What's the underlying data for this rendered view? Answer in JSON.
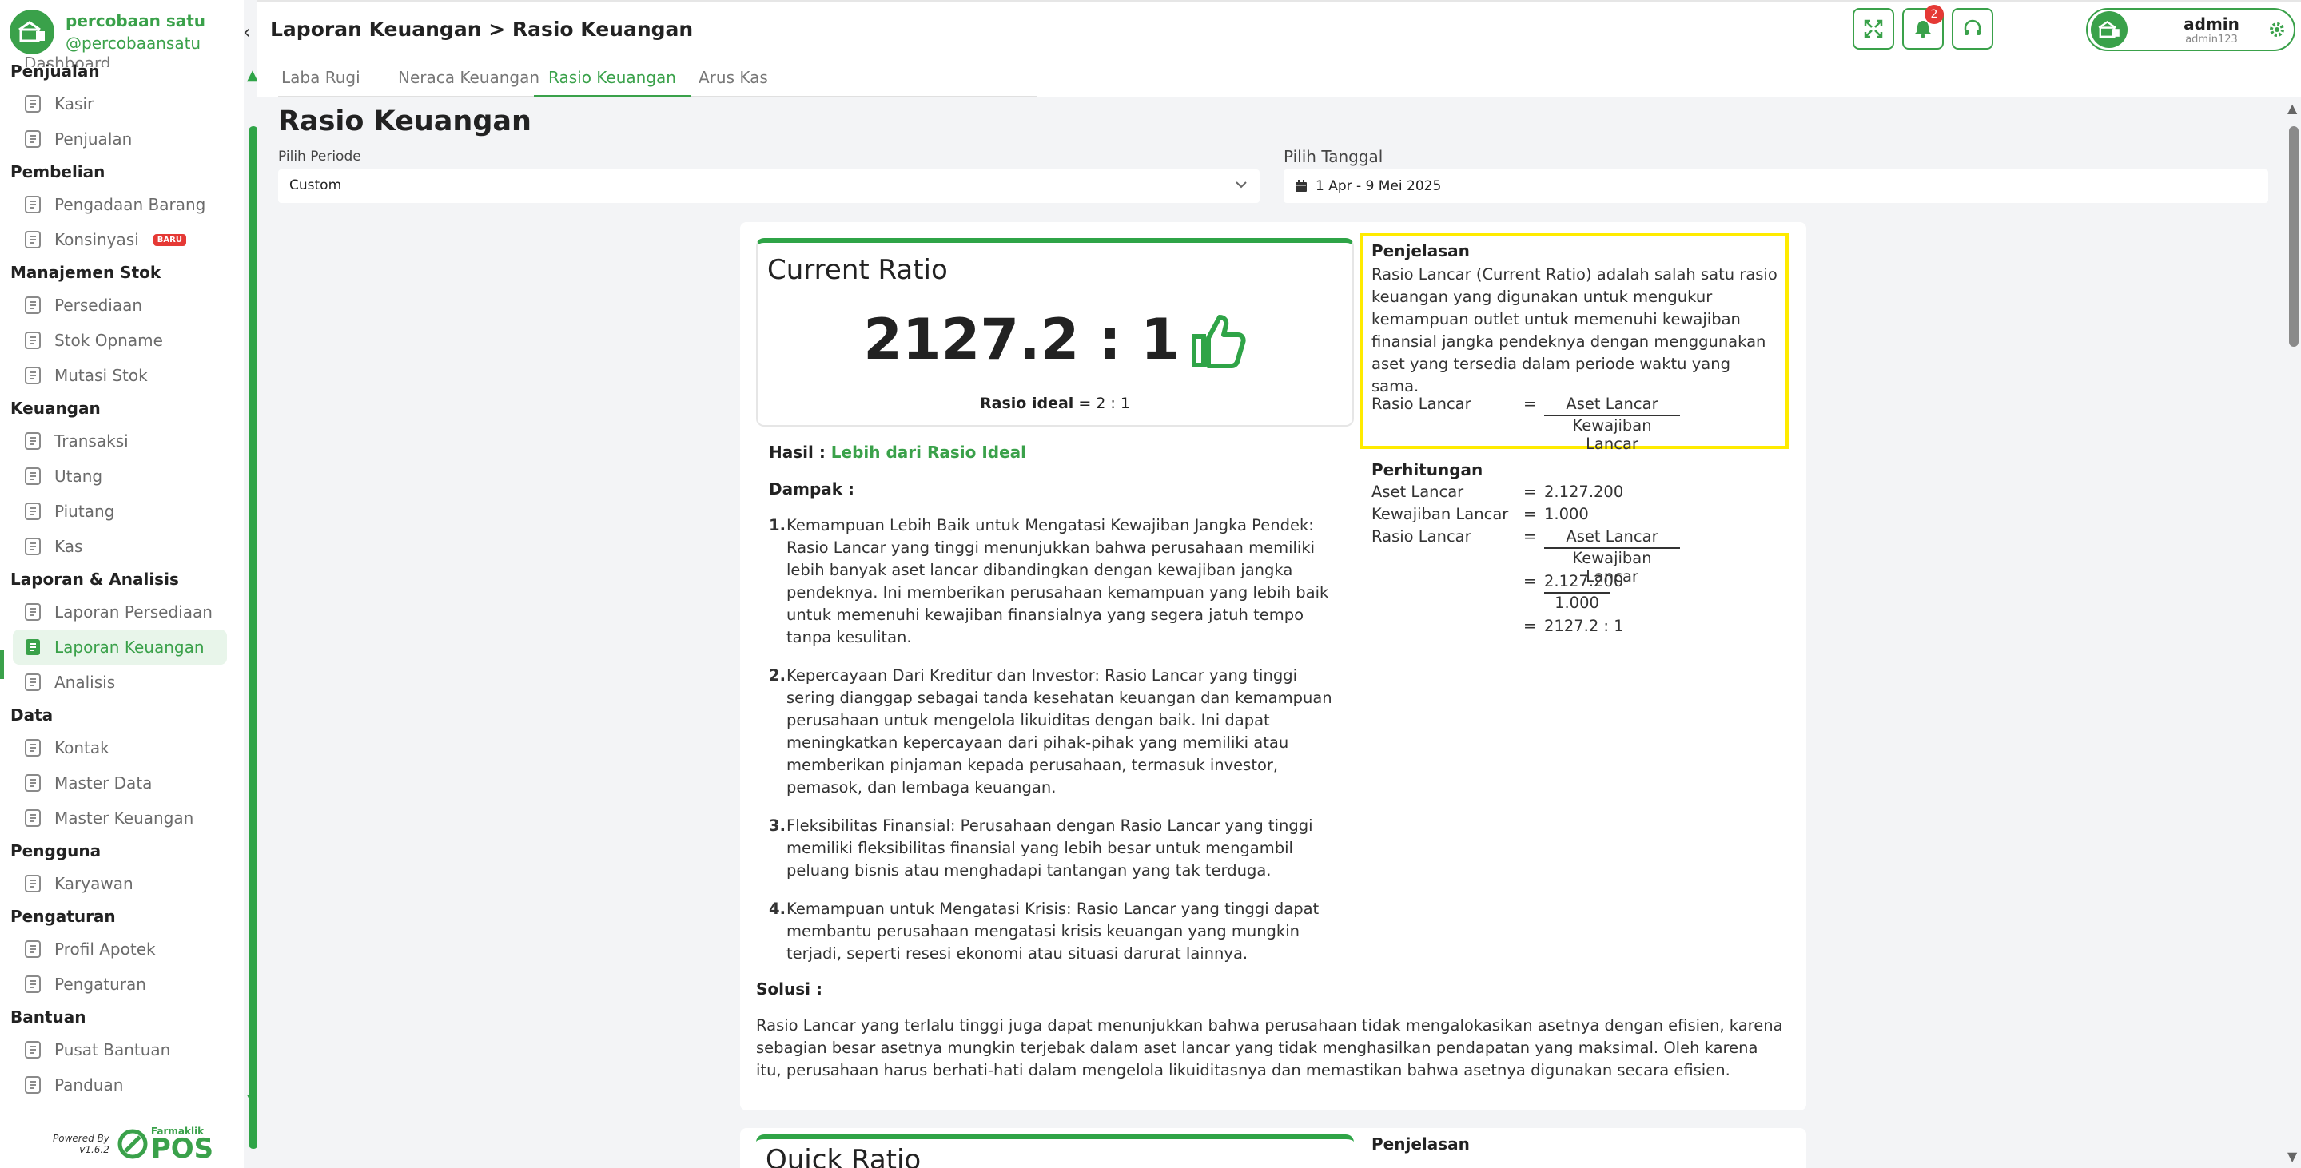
{
  "brand": {
    "name": "percobaan satu",
    "handle": "@percobaansatu"
  },
  "sidebar": {
    "partial_item": "Dashboard",
    "groups": [
      {
        "title": "Penjualan",
        "items": [
          {
            "label": "Kasir",
            "icon": "cashier-icon"
          },
          {
            "label": "Penjualan",
            "icon": "shop-icon"
          }
        ]
      },
      {
        "title": "Pembelian",
        "items": [
          {
            "label": "Pengadaan Barang",
            "icon": "procurement-icon"
          },
          {
            "label": "Konsinyasi",
            "icon": "box-icon",
            "badge": "BARU"
          }
        ]
      },
      {
        "title": "Manajemen Stok",
        "items": [
          {
            "label": "Persediaan",
            "icon": "inventory-icon"
          },
          {
            "label": "Stok Opname",
            "icon": "stock-opname-icon"
          },
          {
            "label": "Mutasi Stok",
            "icon": "stock-mutation-icon"
          }
        ]
      },
      {
        "title": "Keuangan",
        "items": [
          {
            "label": "Transaksi",
            "icon": "transaction-icon"
          },
          {
            "label": "Utang",
            "icon": "debt-icon"
          },
          {
            "label": "Piutang",
            "icon": "receivable-icon"
          },
          {
            "label": "Kas",
            "icon": "cash-icon"
          }
        ]
      },
      {
        "title": "Laporan & Analisis",
        "items": [
          {
            "label": "Laporan Persediaan",
            "icon": "clipboard-icon"
          },
          {
            "label": "Laporan Keuangan",
            "icon": "clipboard-filled-icon",
            "active": true
          },
          {
            "label": "Analisis",
            "icon": "analysis-icon"
          }
        ]
      },
      {
        "title": "Data",
        "items": [
          {
            "label": "Kontak",
            "icon": "contact-icon"
          },
          {
            "label": "Master Data",
            "icon": "master-data-icon"
          },
          {
            "label": "Master Keuangan",
            "icon": "finance-master-icon"
          }
        ]
      },
      {
        "title": "Pengguna",
        "items": [
          {
            "label": "Karyawan",
            "icon": "users-icon"
          }
        ]
      },
      {
        "title": "Pengaturan",
        "items": [
          {
            "label": "Profil Apotek",
            "icon": "store-icon"
          },
          {
            "label": "Pengaturan",
            "icon": "gear-icon"
          }
        ]
      },
      {
        "title": "Bantuan",
        "items": [
          {
            "label": "Pusat Bantuan",
            "icon": "help-icon"
          },
          {
            "label": "Panduan",
            "icon": "guide-icon"
          }
        ]
      }
    ],
    "powered": {
      "line1": "Powered By",
      "line2": "v1.6.2",
      "logo_top": "Farmaklik",
      "logo_big": "POS"
    }
  },
  "header": {
    "breadcrumb": "Laporan Keuangan > Rasio Keuangan",
    "notif_count": "2",
    "user_name": "admin",
    "user_sub": "admin123"
  },
  "tabs": [
    "Laba Rugi",
    "Neraca Keuangan",
    "Rasio Keuangan",
    "Arus Kas"
  ],
  "active_tab": 2,
  "page": {
    "title": "Rasio Keuangan",
    "periode_label": "Pilih Periode",
    "periode_value": "Custom",
    "tanggal_label": "Pilih Tanggal",
    "tanggal_value": "1 Apr - 9 Mei 2025"
  },
  "current_ratio": {
    "title": "Current Ratio",
    "value": "2127.2 : 1",
    "ideal_label": "Rasio ideal",
    "ideal_value": "= 2 : 1",
    "hasil_label": "Hasil :",
    "hasil_value": "Lebih dari Rasio Ideal",
    "dampak_label": "Dampak :",
    "dampak": [
      "Kemampuan Lebih Baik untuk Mengatasi Kewajiban Jangka Pendek: Rasio Lancar yang tinggi menunjukkan bahwa perusahaan memiliki lebih banyak aset lancar dibandingkan dengan kewajiban jangka pendeknya. Ini memberikan perusahaan kemampuan yang lebih baik untuk memenuhi kewajiban finansialnya yang segera jatuh tempo tanpa kesulitan.",
      "Kepercayaan Dari Kreditur dan Investor: Rasio Lancar yang tinggi sering dianggap sebagai tanda kesehatan keuangan dan kemampuan perusahaan untuk mengelola likuiditas dengan baik. Ini dapat meningkatkan kepercayaan dari pihak-pihak yang memiliki atau memberikan pinjaman kepada perusahaan, termasuk investor, pemasok, dan lembaga keuangan.",
      "Fleksibilitas Finansial: Perusahaan dengan Rasio Lancar yang tinggi memiliki fleksibilitas finansial yang lebih besar untuk mengambil peluang bisnis atau menghadapi tantangan yang tak terduga.",
      "Kemampuan untuk Mengatasi Krisis: Rasio Lancar yang tinggi dapat membantu perusahaan mengatasi krisis keuangan yang mungkin terjadi, seperti resesi ekonomi atau situasi darurat lainnya."
    ],
    "solusi_label": "Solusi :",
    "solusi": "Rasio Lancar yang terlalu tinggi juga dapat menunjukkan bahwa perusahaan tidak mengalokasikan asetnya dengan efisien, karena sebagian besar asetnya mungkin terjebak dalam aset lancar yang tidak menghasilkan pendapatan yang maksimal. Oleh karena itu, perusahaan harus berhati-hati dalam mengelola likuiditasnya dan memastikan bahwa asetnya digunakan secara efisien.",
    "penjelasan_label": "Penjelasan",
    "penjelasan": "Rasio Lancar (Current Ratio) adalah salah satu rasio keuangan yang digunakan untuk mengukur kemampuan outlet untuk memenuhi kewajiban finansial jangka pendeknya dengan menggunakan aset yang tersedia dalam periode waktu yang sama.",
    "formula": {
      "label": "Rasio Lancar",
      "eq": "=",
      "numerator": "Aset Lancar",
      "denominator": "Kewajiban Lancar"
    },
    "perhitungan_label": "Perhitungan",
    "perhitungan": {
      "aset_label": "Aset Lancar",
      "aset_value": "2.127.200",
      "kewajiban_label": "Kewajiban Lancar",
      "kewajiban_value": "1.000",
      "rasio_label": "Rasio Lancar",
      "frac1_num": "Aset Lancar",
      "frac1_den": "Kewajiban Lancar",
      "frac2_num": "2.127.200",
      "frac2_den": "1.000",
      "result": "2127.2 : 1",
      "eq": "="
    }
  },
  "next_card": {
    "title": "Quick Ratio",
    "penjelasan_label": "Penjelasan"
  },
  "colors": {
    "accent": "#3aa14a",
    "highlight": "#ffeb00",
    "badge": "#e53935"
  }
}
